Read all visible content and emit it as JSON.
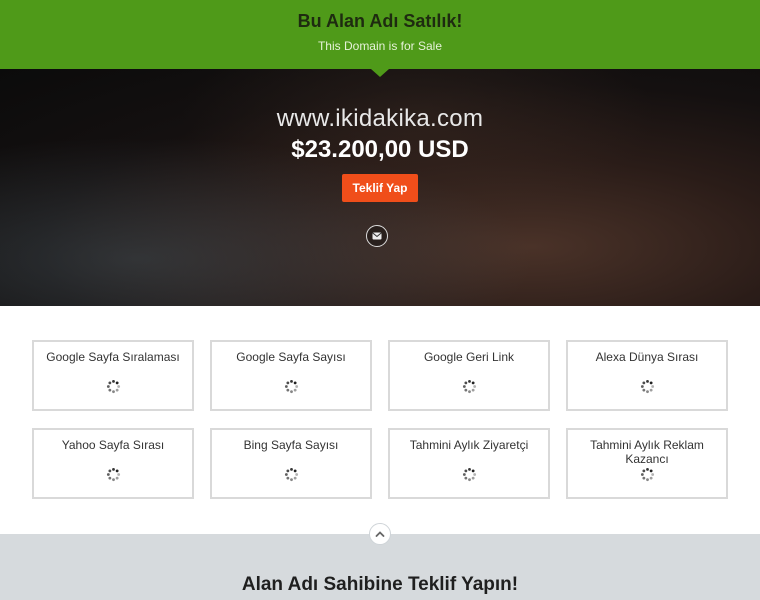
{
  "header": {
    "title": "Bu Alan Adı Satılık!",
    "subtitle": "This Domain is for Sale"
  },
  "hero": {
    "domain": "www.ikidakika.com",
    "price": "$23.200,00 USD",
    "offer_button": "Teklif Yap",
    "mail_icon": "envelope-icon"
  },
  "stats": [
    {
      "label": "Google Sayfa Sıralaması"
    },
    {
      "label": "Google Sayfa Sayısı"
    },
    {
      "label": "Google Geri Link"
    },
    {
      "label": "Alexa Dünya Sırası"
    },
    {
      "label": "Yahoo Sayfa Sırası"
    },
    {
      "label": "Bing Sayfa Sayısı"
    },
    {
      "label": "Tahmini Aylık Ziyaretçi"
    },
    {
      "label": "Tahmini Aylık Reklam Kazancı"
    }
  ],
  "footer": {
    "title": "Alan Adı Sahibine Teklif Yapın!",
    "scroll_icon": "chevron-up-icon"
  },
  "colors": {
    "header_green": "#4f9a19",
    "offer_orange": "#f04e1a",
    "footer_gray": "#d6dadd"
  }
}
